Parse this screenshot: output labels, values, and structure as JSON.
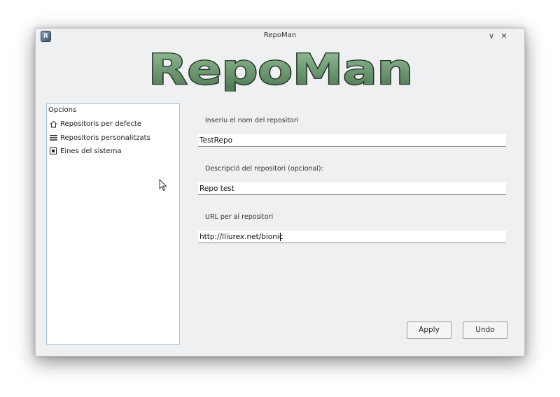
{
  "window": {
    "title": "RepoMan",
    "icon_letter": "R",
    "minimize_glyph": "∨",
    "close_glyph": "✕"
  },
  "logo": {
    "text": "RepoMan"
  },
  "sidebar": {
    "heading": "Opcions",
    "items": [
      {
        "label": "Repositoris per defecte",
        "icon": "home-icon"
      },
      {
        "label": "Repositoris personalitzats",
        "icon": "menu-lines-icon"
      },
      {
        "label": "Eines del sistema",
        "icon": "system-tools-icon"
      }
    ]
  },
  "form": {
    "name_label": "Inseriu el nom del repositori",
    "name_value": "TestRepo",
    "desc_label": "Descripció del repositori (opcional):",
    "desc_value": "Repo test",
    "url_label": "URL per al repositori",
    "url_value": "http://lliurex.net/bionic"
  },
  "buttons": {
    "apply": "Apply",
    "undo": "Undo"
  },
  "colors": {
    "logo_fill": "#6f9a73",
    "window_bg": "#eff0f1",
    "sidebar_border": "#9fc2e0"
  }
}
